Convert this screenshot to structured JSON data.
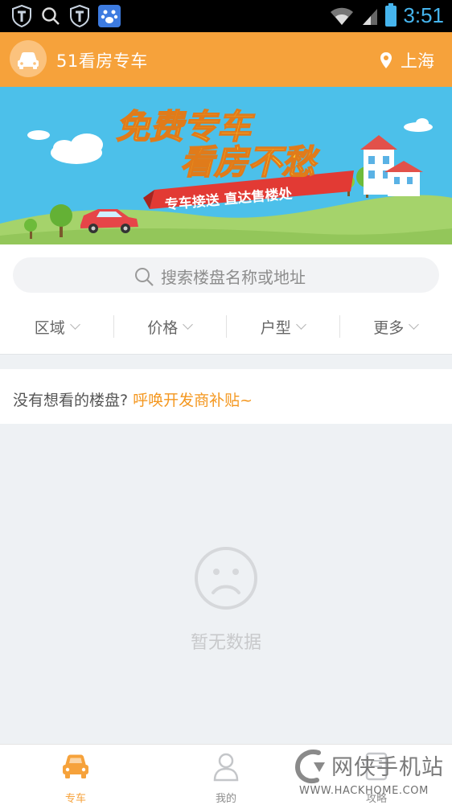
{
  "status_bar": {
    "time": "3:51"
  },
  "header": {
    "title": "51看房专车",
    "city": "上海"
  },
  "banner": {
    "headline_1": "免费专车",
    "headline_2": "看房不愁",
    "ribbon": "专车接送  直达售楼处"
  },
  "search": {
    "placeholder": "搜索楼盘名称或地址"
  },
  "filters": [
    {
      "label": "区域"
    },
    {
      "label": "价格"
    },
    {
      "label": "户型"
    },
    {
      "label": "更多"
    }
  ],
  "prompt": {
    "text": "没有想看的楼盘?",
    "link": "呼唤开发商补贴~"
  },
  "empty_state": {
    "text": "暂无数据"
  },
  "tabs": [
    {
      "label": "专车",
      "active": true
    },
    {
      "label": "我的",
      "active": false
    },
    {
      "label": "攻略",
      "active": false
    }
  ],
  "watermark": {
    "brand": "网侠手机站",
    "url": "WWW.HACKHOME.COM"
  },
  "colors": {
    "primary": "#f6a23b",
    "accent_text": "#f4971f",
    "sky": "#4cc0ea",
    "grass": "#a5d36b"
  }
}
